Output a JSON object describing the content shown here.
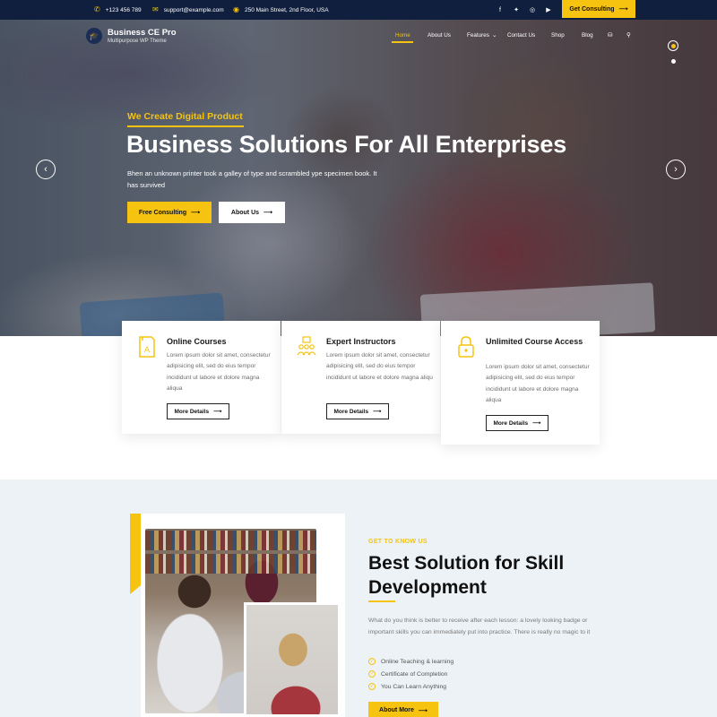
{
  "topbar": {
    "phone": "+123 456 789",
    "email": "support@example.com",
    "address": "250 Main Street, 2nd Floor, USA",
    "social_icons": [
      "facebook-icon",
      "twitter-icon",
      "instagram-icon",
      "youtube-icon"
    ],
    "cta_label": "Get Consulting"
  },
  "brand": {
    "name": "Business CE Pro",
    "tagline": "Multipurpose WP Theme"
  },
  "nav": {
    "items": [
      "Home",
      "About Us",
      "Features",
      "Contact Us",
      "Shop",
      "Blog"
    ],
    "active": "Home"
  },
  "hero": {
    "kicker": "We Create Digital Product",
    "title": "Business Solutions For All Enterprises",
    "description": "Bhen an unknown printer took a galley of type and scrambled ype specimen book. It has survived",
    "primary_button": "Free Consulting",
    "secondary_button": "About Us",
    "slides": 2,
    "active_slide": 1
  },
  "features": [
    {
      "icon": "book-icon",
      "title": "Online Courses",
      "text": "Lorem ipsum dolor sit amet, consectetur adipisicing elit, sed do eius tempor incididunt ut labore et dolore magna aliqua",
      "button": "More Details"
    },
    {
      "icon": "instructors-icon",
      "title": "Expert Instructors",
      "text": "Lorem ipsum dolor sit amet, consectetur adipisicing elit, sed do eius tempor incididunt ut labore et dolore magna aliqu",
      "button": "More Details"
    },
    {
      "icon": "lock-icon",
      "title": "Unlimited Course Access",
      "text": "Lorem ipsum dolor sit amet, consectetur adipisicing elit, sed do eius tempor incididunt ut labore et dolore magna aliqua",
      "button": "More Details"
    }
  ],
  "about": {
    "kicker": "GET TO KNOW US",
    "title": "Best Solution for Skill Development",
    "description": "What do you think is better to receive after each lesson: a lovely looking badge or important skills you can immediately put into practice. There is really no magic to it",
    "checklist": [
      "Online Teaching & learning",
      "Certificate of Completion",
      "You Can Learn Anything"
    ],
    "button": "About More"
  },
  "colors": {
    "accent": "#f5c310",
    "topbar": "#0f1f3d",
    "section_bg": "#edf2f6"
  }
}
